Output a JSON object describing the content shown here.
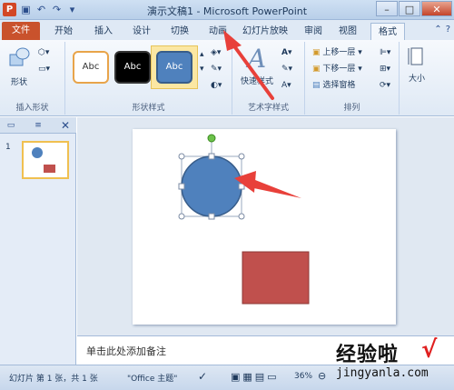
{
  "window": {
    "title": "演示文稿1 - Microsoft PowerPoint",
    "app_icon": "P"
  },
  "quick_access": {
    "icons": [
      "save-icon",
      "undo-icon",
      "redo-icon",
      "customize-icon"
    ]
  },
  "tabs": [
    {
      "label": "文件",
      "id": "file"
    },
    {
      "label": "开始",
      "id": "home"
    },
    {
      "label": "插入",
      "id": "insert"
    },
    {
      "label": "设计",
      "id": "design"
    },
    {
      "label": "切换",
      "id": "transitions"
    },
    {
      "label": "动画",
      "id": "animations"
    },
    {
      "label": "幻灯片放映",
      "id": "slideshow"
    },
    {
      "label": "审阅",
      "id": "review"
    },
    {
      "label": "视图",
      "id": "view"
    },
    {
      "label": "格式",
      "id": "format",
      "active": true
    }
  ],
  "ribbon": {
    "insert_shapes": {
      "label": "插入形状",
      "shapes_button": "形状"
    },
    "shape_styles": {
      "label": "形状样式",
      "styles": [
        "Abc",
        "Abc",
        "Abc"
      ]
    },
    "wordart_styles": {
      "label": "艺术字样式",
      "quick_styles": "快速样式",
      "glyph": "A"
    },
    "arrange": {
      "label": "排列",
      "bring_forward": "上移一层",
      "send_backward": "下移一层",
      "selection_pane": "选择窗格"
    },
    "size": {
      "label": "大小"
    }
  },
  "slide_pane": {
    "slide_number": "1"
  },
  "notes": {
    "placeholder": "单击此处添加备注"
  },
  "status_bar": {
    "slide_info": "幻灯片 第 1 张，共 1 张",
    "theme": "\"Office 主题\"",
    "zoom": "36%"
  },
  "slide_content": {
    "circle_color": "#4f81bd",
    "rect_color": "#c0504d"
  },
  "watermark": {
    "line1": "经验啦",
    "check": "√",
    "line2": "jingyanla.com"
  },
  "colors": {
    "accent_file": "#c9522c",
    "arrow": "#e8403a"
  }
}
